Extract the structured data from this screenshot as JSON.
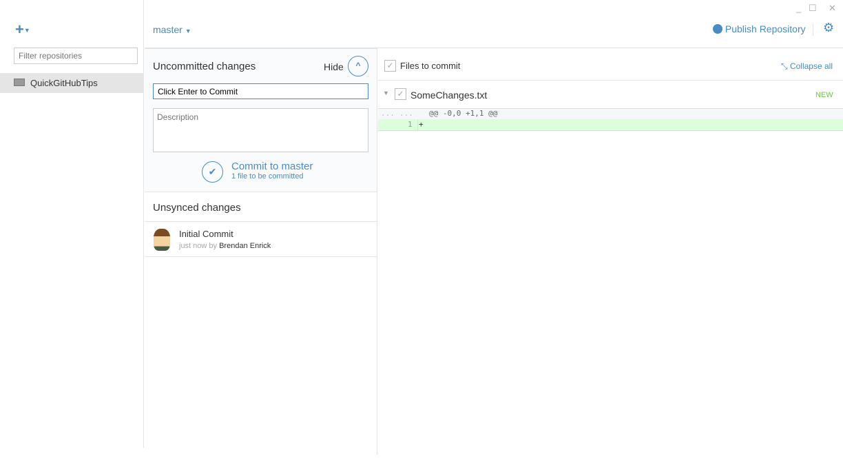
{
  "window": {
    "minimize": "_",
    "maximize": "☐",
    "close": "✕"
  },
  "sidebar": {
    "add_icon": "+",
    "filter_placeholder": "Filter repositories",
    "repos": [
      {
        "name": "QuickGitHubTips"
      }
    ]
  },
  "header": {
    "branch": "master",
    "publish": "Publish Repository"
  },
  "uncommitted": {
    "title": "Uncommitted changes",
    "hide": "Hide",
    "summary": "Click Enter to Commit",
    "description_placeholder": "Description",
    "commit_label": "Commit to master",
    "commit_sub": "1 file to be committed"
  },
  "unsynced": {
    "title": "Unsynced changes",
    "commits": [
      {
        "title": "Initial Commit",
        "time": "just now by",
        "author": "Brendan Enrick"
      }
    ]
  },
  "files": {
    "title": "Files to commit",
    "collapse": "Collapse all",
    "items": [
      {
        "name": "SomeChanges.txt",
        "status": "NEW"
      }
    ]
  },
  "diff": {
    "hunk_old": "...",
    "hunk_new": "...",
    "hunk": "@@ -0,0 +1,1 @@",
    "lines": [
      {
        "old": "",
        "new": "1",
        "text": "+"
      }
    ]
  },
  "colors": {
    "accent": "#4a8bc6",
    "added_bg": "#dbffdb",
    "new_badge": "#6cc644"
  }
}
